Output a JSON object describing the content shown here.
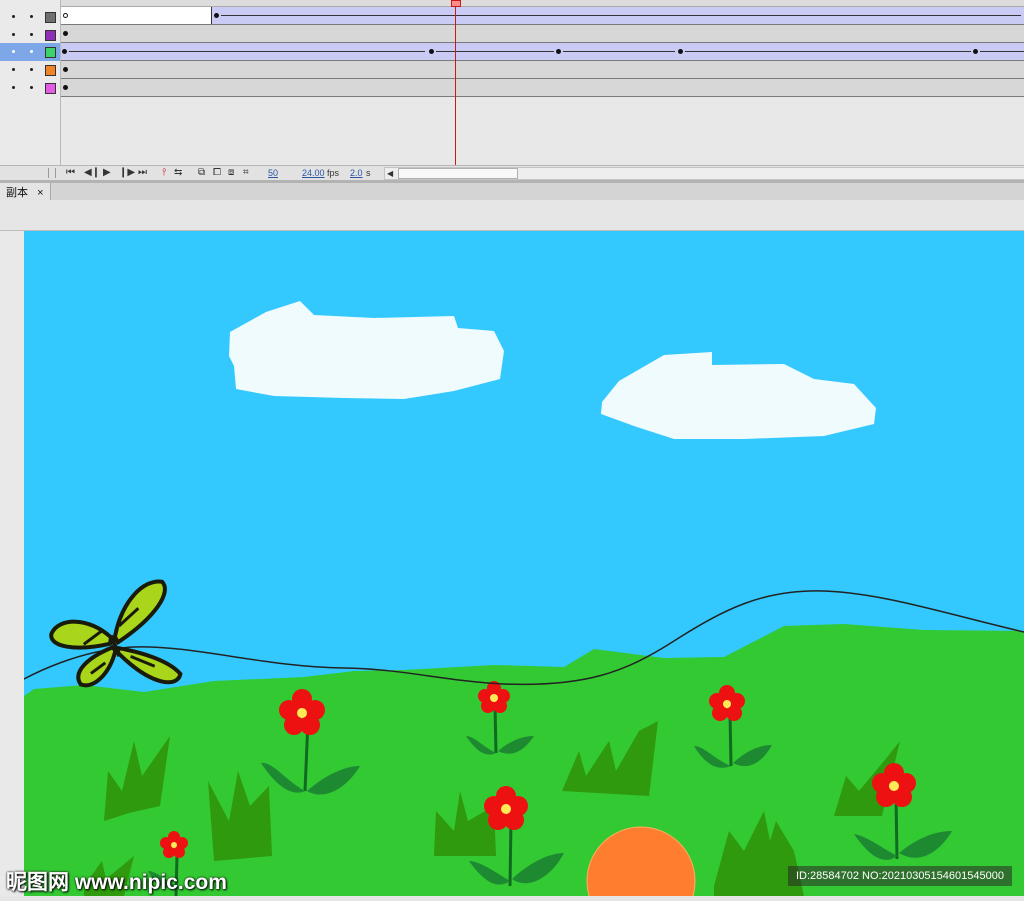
{
  "timeline": {
    "layers": [
      {
        "swatch_color": "#6f6f6f"
      },
      {
        "swatch_color": "#8e2fb5"
      },
      {
        "swatch_color": "#3cd36a",
        "selected": true
      },
      {
        "swatch_color": "#f08428"
      },
      {
        "swatch_color": "#e25ce6"
      }
    ],
    "current_frame": "50",
    "fps": "24.00",
    "fps_unit": "fps",
    "elapsed": "2.0",
    "elapsed_unit": "s",
    "playback_icons": [
      "first-frame-icon",
      "step-back-icon",
      "play-icon",
      "step-forward-icon",
      "last-frame-icon"
    ]
  },
  "document": {
    "tab_title": "副本",
    "tab_close": "×"
  },
  "scene": {
    "sky_color": "#33c9ff",
    "grass_color": "#33c933",
    "flower_color": "#ee1111",
    "sun_color": "#ff7d2e"
  },
  "watermark": {
    "left_text": "昵图网 www.nipic.com",
    "right_text": "ID:28584702 NO:20210305154601545000"
  }
}
